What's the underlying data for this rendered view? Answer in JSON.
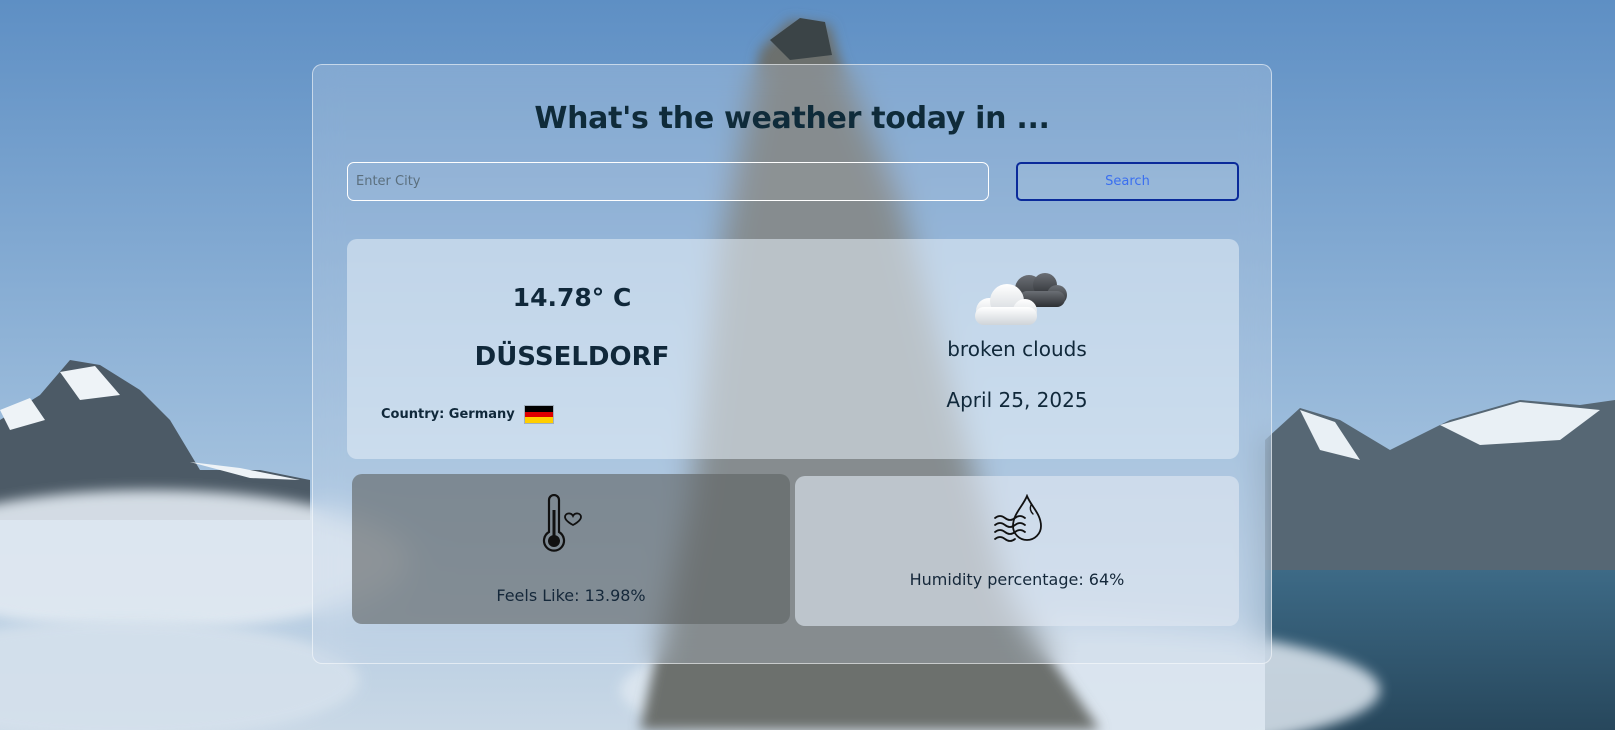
{
  "header": {
    "title": "What's the weather today in ..."
  },
  "search": {
    "placeholder": "Enter City",
    "value": "",
    "button_label": "Search"
  },
  "current": {
    "temperature": "14.78° C",
    "city": "DÜSSELDORF",
    "country_label": "Country: Germany",
    "flag": {
      "icon": "germany-flag-icon",
      "colors": [
        "#000000",
        "#dd0000",
        "#ffce00"
      ]
    },
    "weather_icon": "broken-clouds-icon",
    "condition": "broken clouds",
    "date": "April 25, 2025"
  },
  "details": {
    "feels_like": {
      "icon": "thermometer-heart-icon",
      "label": "Feels Like: 13.98%"
    },
    "humidity": {
      "icon": "humidity-drop-icon",
      "label": "Humidity percentage: 64%"
    }
  }
}
